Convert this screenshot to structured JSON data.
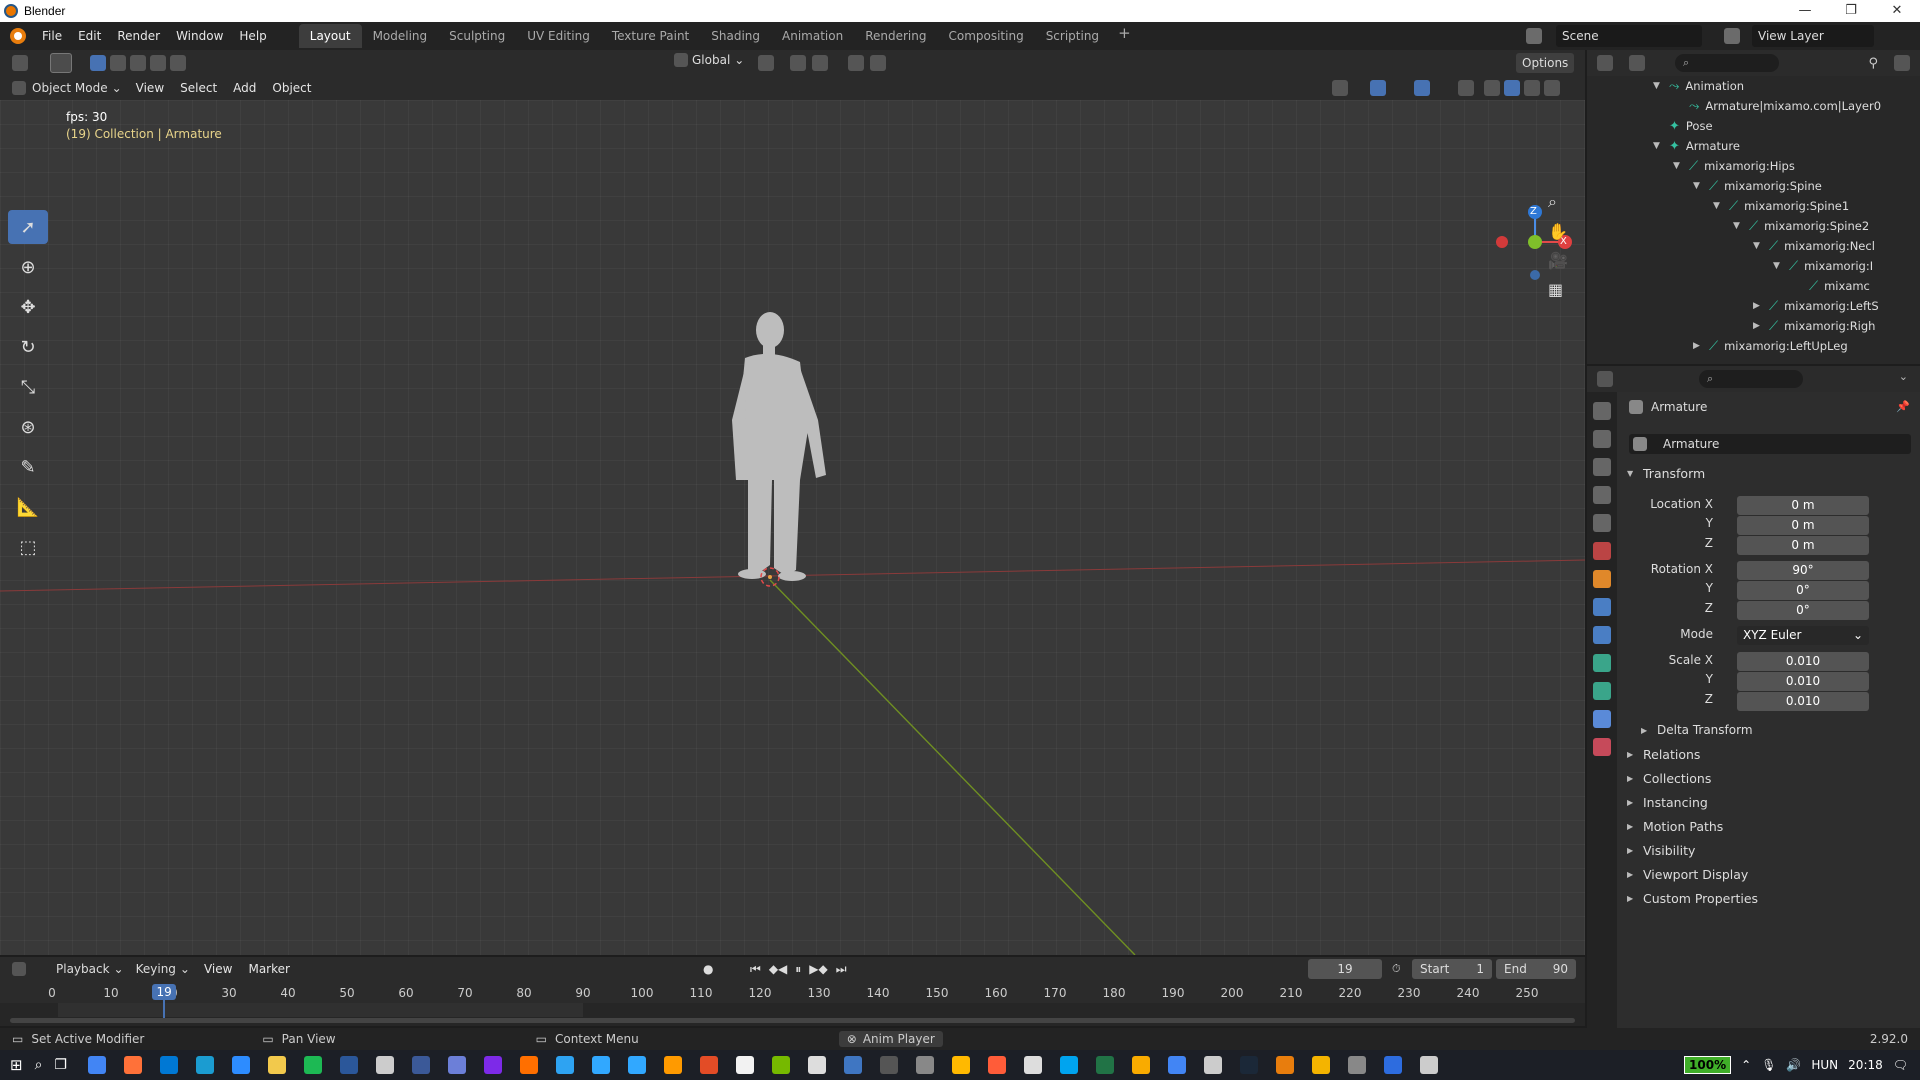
{
  "window": {
    "title": "Blender",
    "controls": [
      "—",
      "❐",
      "✕"
    ]
  },
  "menu": [
    "File",
    "Edit",
    "Render",
    "Window",
    "Help"
  ],
  "workspaces": [
    "Layout",
    "Modeling",
    "Sculpting",
    "UV Editing",
    "Texture Paint",
    "Shading",
    "Animation",
    "Rendering",
    "Compositing",
    "Scripting"
  ],
  "workspace_add": "+",
  "scene": "Scene",
  "view_layer": "View Layer",
  "toolbar": {
    "transform_orientation": "Global",
    "options": "Options"
  },
  "viewport_header": {
    "mode": "Object Mode",
    "items": [
      "View",
      "Select",
      "Add",
      "Object"
    ]
  },
  "viewport": {
    "fps": "fps: 30",
    "info": "(19) Collection | Armature"
  },
  "gizmo": {
    "z": "Z",
    "x": "X"
  },
  "outliner": [
    {
      "label": "Animation",
      "tri": "▼",
      "icon": "⤳",
      "indent": 0
    },
    {
      "label": "Armature|mixamo.com|Layer0",
      "tri": "",
      "icon": "⤳",
      "indent": 1
    },
    {
      "label": "Pose",
      "tri": "",
      "icon": "✦",
      "indent": 0
    },
    {
      "label": "Armature",
      "tri": "▼",
      "icon": "✦",
      "indent": 0
    },
    {
      "label": "mixamorig:Hips",
      "tri": "▼",
      "icon": "⟋",
      "indent": 1
    },
    {
      "label": "mixamorig:Spine",
      "tri": "▼",
      "icon": "⟋",
      "indent": 2
    },
    {
      "label": "mixamorig:Spine1",
      "tri": "▼",
      "icon": "⟋",
      "indent": 3
    },
    {
      "label": "mixamorig:Spine2",
      "tri": "▼",
      "icon": "⟋",
      "indent": 4
    },
    {
      "label": "mixamorig:Necl",
      "tri": "▼",
      "icon": "⟋",
      "indent": 5
    },
    {
      "label": "mixamorig:I",
      "tri": "▼",
      "icon": "⟋",
      "indent": 6
    },
    {
      "label": "mixamc",
      "tri": "",
      "icon": "⟋",
      "indent": 7
    },
    {
      "label": "mixamorig:LeftS",
      "tri": "▶",
      "icon": "⟋",
      "indent": 5
    },
    {
      "label": "mixamorig:Righ",
      "tri": "▶",
      "icon": "⟋",
      "indent": 5
    },
    {
      "label": "mixamorig:LeftUpLeg",
      "tri": "▶",
      "icon": "⟋",
      "indent": 2
    }
  ],
  "properties": {
    "object_name": "Armature",
    "name_field": "Armature",
    "transform": {
      "title": "Transform",
      "location_label": "Location X",
      "location": [
        "0 m",
        "0 m",
        "0 m"
      ],
      "rotation_label": "Rotation X",
      "rotation": [
        "90°",
        "0°",
        "0°"
      ],
      "axis_y": "Y",
      "axis_z": "Z",
      "mode_label": "Mode",
      "mode": "XYZ Euler",
      "scale_label": "Scale X",
      "scale": [
        "0.010",
        "0.010",
        "0.010"
      ]
    },
    "delta": "Delta Transform",
    "panels": [
      "Relations",
      "Collections",
      "Instancing",
      "Motion Paths",
      "Visibility",
      "Viewport Display",
      "Custom Properties"
    ]
  },
  "timeline": {
    "menus": [
      "Playback",
      "Keying",
      "View",
      "Marker"
    ],
    "current_frame": "19",
    "start_label": "Start",
    "start": "1",
    "end_label": "End",
    "end": "90",
    "ticks": [
      "0",
      "10",
      "20",
      "30",
      "40",
      "50",
      "60",
      "70",
      "80",
      "90",
      "100",
      "110",
      "120",
      "130",
      "140",
      "150",
      "160",
      "170",
      "180",
      "190",
      "200",
      "210",
      "220",
      "230",
      "240",
      "250"
    ],
    "playhead": "19"
  },
  "status": {
    "left": "Set Active Modifier",
    "mid": "Pan View",
    "context": "Context Menu",
    "player": "Anim Player",
    "version": "2.92.0"
  },
  "taskbar": {
    "zoom": "100%",
    "lang": "HUN",
    "time": "20:18",
    "colors": [
      "#4285f4",
      "#ff7139",
      "#0078d4",
      "#1b9cd1",
      "#2d8cff",
      "#f2c94c",
      "#1db954",
      "#2b579a",
      "#cccccc",
      "#3b5998",
      "#6c7fd8",
      "#7d2ae8",
      "#ff6f00",
      "#2ea3f2",
      "#31a8ff",
      "#31a8ff",
      "#ff9a00",
      "#e34c26",
      "#f2f2f2",
      "#76b900",
      "#dddddd",
      "#3f76c2",
      "#555555",
      "#888888",
      "#ffb900",
      "#ff5c39",
      "#dddddd",
      "#00a4ef",
      "#217346",
      "#f9ab00",
      "#4285f4",
      "#cccccc",
      "#1b2838",
      "#e87d0d",
      "#f4b400",
      "#888888",
      "#2d6cdf",
      "#cccccc"
    ]
  }
}
